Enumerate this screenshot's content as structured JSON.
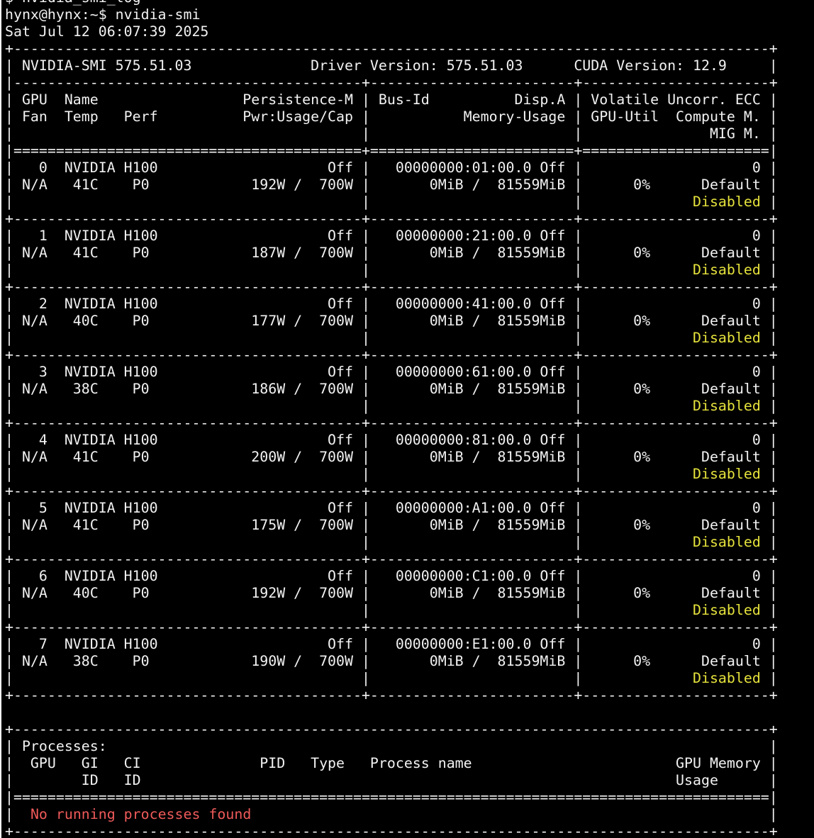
{
  "colors": {
    "background": "#000000",
    "foreground": "#f2f2f2",
    "disabled_yellow": "#e5e23c",
    "no_process_red": "#ef5a5a"
  },
  "terminal": {
    "lines": [
      [
        {
          "t": "$ nvidia_smi_log"
        }
      ],
      [
        {
          "t": "hynx@hynx:~$ nvidia-smi"
        }
      ],
      [
        {
          "t": "Sat Jul 12 06:07:39 2025"
        }
      ],
      [
        {
          "t": "+-----------------------------------------------------------------------------------------+"
        }
      ],
      [
        {
          "t": "| NVIDIA-SMI 575.51.03              Driver Version: 575.51.03      CUDA Version: 12.9     |"
        }
      ],
      [
        {
          "t": "|-----------------------------------------+------------------------+----------------------+"
        }
      ],
      [
        {
          "t": "| GPU  Name                 Persistence-M | Bus-Id          Disp.A | Volatile Uncorr. ECC |"
        }
      ],
      [
        {
          "t": "| Fan  Temp   Perf          Pwr:Usage/Cap |           Memory-Usage | GPU-Util  Compute M. |"
        }
      ],
      [
        {
          "t": "|                                         |                        |               MIG M. |"
        }
      ],
      [
        {
          "t": "|=========================================+========================+======================|"
        }
      ],
      [
        {
          "t": "|   0  NVIDIA H100                    Off |   00000000:01:00.0 Off |                    0 |"
        }
      ],
      [
        {
          "t": "| N/A   41C    P0            192W /  700W |       0MiB /  81559MiB |      0%      Default |"
        }
      ],
      [
        {
          "t": "|                                         |                        |             "
        },
        {
          "t": "Disabled",
          "c": "yellow"
        },
        {
          "t": " |"
        }
      ],
      [
        {
          "t": "+-----------------------------------------+------------------------+----------------------+"
        }
      ],
      [
        {
          "t": "|   1  NVIDIA H100                    Off |   00000000:21:00.0 Off |                    0 |"
        }
      ],
      [
        {
          "t": "| N/A   41C    P0            187W /  700W |       0MiB /  81559MiB |      0%      Default |"
        }
      ],
      [
        {
          "t": "|                                         |                        |             "
        },
        {
          "t": "Disabled",
          "c": "yellow"
        },
        {
          "t": " |"
        }
      ],
      [
        {
          "t": "+-----------------------------------------+------------------------+----------------------+"
        }
      ],
      [
        {
          "t": "|   2  NVIDIA H100                    Off |   00000000:41:00.0 Off |                    0 |"
        }
      ],
      [
        {
          "t": "| N/A   40C    P0            177W /  700W |       0MiB /  81559MiB |      0%      Default |"
        }
      ],
      [
        {
          "t": "|                                         |                        |             "
        },
        {
          "t": "Disabled",
          "c": "yellow"
        },
        {
          "t": " |"
        }
      ],
      [
        {
          "t": "+-----------------------------------------+------------------------+----------------------+"
        }
      ],
      [
        {
          "t": "|   3  NVIDIA H100                    Off |   00000000:61:00.0 Off |                    0 |"
        }
      ],
      [
        {
          "t": "| N/A   38C    P0            186W /  700W |       0MiB /  81559MiB |      0%      Default |"
        }
      ],
      [
        {
          "t": "|                                         |                        |             "
        },
        {
          "t": "Disabled",
          "c": "yellow"
        },
        {
          "t": " |"
        }
      ],
      [
        {
          "t": "+-----------------------------------------+------------------------+----------------------+"
        }
      ],
      [
        {
          "t": "|   4  NVIDIA H100                    Off |   00000000:81:00.0 Off |                    0 |"
        }
      ],
      [
        {
          "t": "| N/A   41C    P0            200W /  700W |       0MiB /  81559MiB |      0%      Default |"
        }
      ],
      [
        {
          "t": "|                                         |                        |             "
        },
        {
          "t": "Disabled",
          "c": "yellow"
        },
        {
          "t": " |"
        }
      ],
      [
        {
          "t": "+-----------------------------------------+------------------------+----------------------+"
        }
      ],
      [
        {
          "t": "|   5  NVIDIA H100                    Off |   00000000:A1:00.0 Off |                    0 |"
        }
      ],
      [
        {
          "t": "| N/A   41C    P0            175W /  700W |       0MiB /  81559MiB |      0%      Default |"
        }
      ],
      [
        {
          "t": "|                                         |                        |             "
        },
        {
          "t": "Disabled",
          "c": "yellow"
        },
        {
          "t": " |"
        }
      ],
      [
        {
          "t": "+-----------------------------------------+------------------------+----------------------+"
        }
      ],
      [
        {
          "t": "|   6  NVIDIA H100                    Off |   00000000:C1:00.0 Off |                    0 |"
        }
      ],
      [
        {
          "t": "| N/A   40C    P0            192W /  700W |       0MiB /  81559MiB |      0%      Default |"
        }
      ],
      [
        {
          "t": "|                                         |                        |             "
        },
        {
          "t": "Disabled",
          "c": "yellow"
        },
        {
          "t": " |"
        }
      ],
      [
        {
          "t": "+-----------------------------------------+------------------------+----------------------+"
        }
      ],
      [
        {
          "t": "|   7  NVIDIA H100                    Off |   00000000:E1:00.0 Off |                    0 |"
        }
      ],
      [
        {
          "t": "| N/A   38C    P0            190W /  700W |       0MiB /  81559MiB |      0%      Default |"
        }
      ],
      [
        {
          "t": "|                                         |                        |             "
        },
        {
          "t": "Disabled",
          "c": "yellow"
        },
        {
          "t": " |"
        }
      ],
      [
        {
          "t": "+-----------------------------------------+------------------------+----------------------+"
        }
      ],
      [
        {
          "t": ""
        }
      ],
      [
        {
          "t": "+-----------------------------------------------------------------------------------------+"
        }
      ],
      [
        {
          "t": "| Processes:                                                                              |"
        }
      ],
      [
        {
          "t": "|  GPU   GI   CI              PID   Type   Process name                        GPU Memory |"
        }
      ],
      [
        {
          "t": "|        ID   ID                                                               Usage      |"
        }
      ],
      [
        {
          "t": "|=========================================================================================|"
        }
      ],
      [
        {
          "t": "|  "
        },
        {
          "t": "No running processes found",
          "c": "red"
        },
        {
          "t": "                                                             |"
        }
      ],
      [
        {
          "t": "+-----------------------------------------------------------------------------------------+"
        }
      ]
    ]
  }
}
